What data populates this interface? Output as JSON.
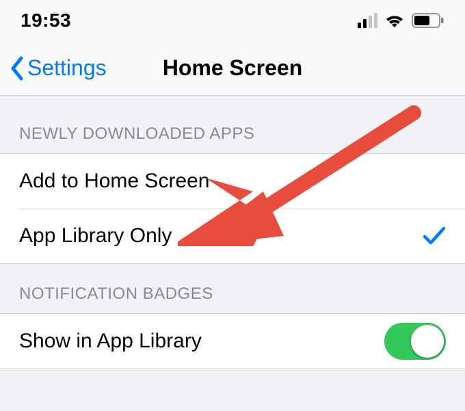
{
  "status": {
    "time": "19:53"
  },
  "nav": {
    "back_label": "Settings",
    "title": "Home Screen"
  },
  "sections": {
    "newly_downloaded": {
      "header": "NEWLY DOWNLOADED APPS",
      "options": [
        {
          "label": "Add to Home Screen",
          "selected": false
        },
        {
          "label": "App Library Only",
          "selected": true
        }
      ]
    },
    "notification_badges": {
      "header": "NOTIFICATION BADGES",
      "row": {
        "label": "Show in App Library",
        "enabled": true
      }
    }
  },
  "colors": {
    "link": "#007aff",
    "toggle_on": "#34c759",
    "annotation": "#e84c3d"
  }
}
